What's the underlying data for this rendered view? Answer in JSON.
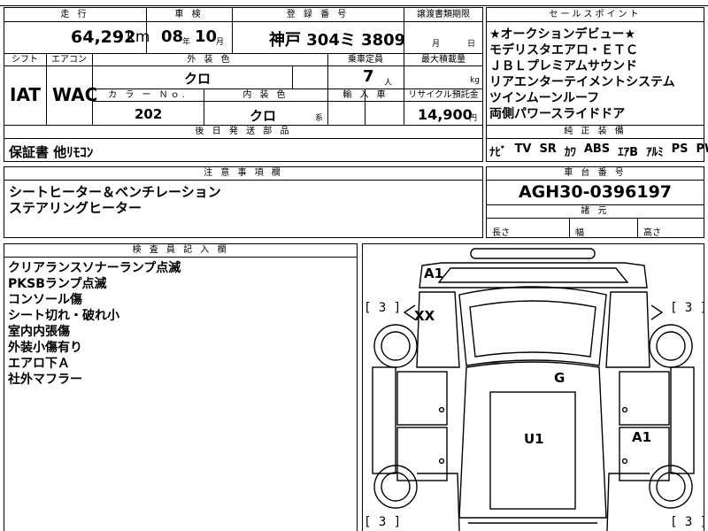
{
  "header_labels": {
    "mileage": "走 行",
    "inspection": "車 検",
    "registration": "登 録 番 号",
    "transfer_deadline": "譲渡書類期限",
    "sales_points": "セールスポイント",
    "shift": "シフト",
    "aircon": "エアコン",
    "exterior_color": "外 装 色",
    "capacity": "乗車定員",
    "max_load": "最大積載量",
    "color_no": "カ ラ ー Ｎｏ.",
    "interior_color": "内 装 色",
    "import": "輸 入 車",
    "recycle": "リサイクル預託金",
    "genuine_equipment": "純 正 装 備",
    "post_shipping": "後 日 発 送 部 品",
    "notes": "注 意 事 項 欄",
    "chassis_no": "車 台 番 号",
    "specs": "諸 元",
    "inspector_notes": "検 査 員 記 入 欄"
  },
  "vehicle": {
    "mileage_value": "64,292",
    "mileage_unit": "km",
    "inspection_year": "08",
    "year_unit": "年",
    "inspection_month": "10",
    "month_unit": "月",
    "registration_number": "神戸  304ミ 3809",
    "transfer_month_unit": "月",
    "transfer_day_unit": "日",
    "shift": "IAT",
    "aircon": "WAC",
    "exterior_color": "クロ",
    "capacity": "7",
    "capacity_unit": "人",
    "max_load_unit": "kg",
    "color_no": "202",
    "interior_color": "クロ",
    "interior_suffix": "系",
    "recycle_fee": "14,900",
    "recycle_unit": "円",
    "chassis_number": "AGH30-0396197",
    "length_label": "長さ",
    "width_label": "幅",
    "height_label": "高さ"
  },
  "sales_points": [
    "★オークションデビュー★",
    "モデリスタエアロ・ＥＴＣ",
    "ＪＢＬプレミアムサウンド",
    "リアエンターテイメントシステム",
    "ツインムーンルーフ",
    "両側パワースライドドア"
  ],
  "equipment": [
    "ﾅﾋﾞ",
    "TV",
    "SR",
    "ｶﾜ",
    "ABS",
    "ｴｱB",
    "ｱﾙﾐ",
    "PS",
    "PW"
  ],
  "post_shipping_items": "保証書  他ﾘﾓｺﾝ",
  "notes_lines": [
    "シートヒーター＆ベンチレーション",
    "ステアリングヒーター"
  ],
  "inspector_lines": [
    "クリアランスソナーランプ点滅",
    "PKSBランプ点滅",
    "コンソール傷",
    "シート切れ・破れ小",
    "室内内張傷",
    "外装小傷有り",
    "エアロ下Ａ",
    "社外マフラー"
  ],
  "diagram": {
    "tire_bracket": "[ 3 ]",
    "label_a1_front": "A1",
    "label_xx": "XX",
    "label_g": "G",
    "label_u1": "U1",
    "label_a1_side": "A1"
  }
}
